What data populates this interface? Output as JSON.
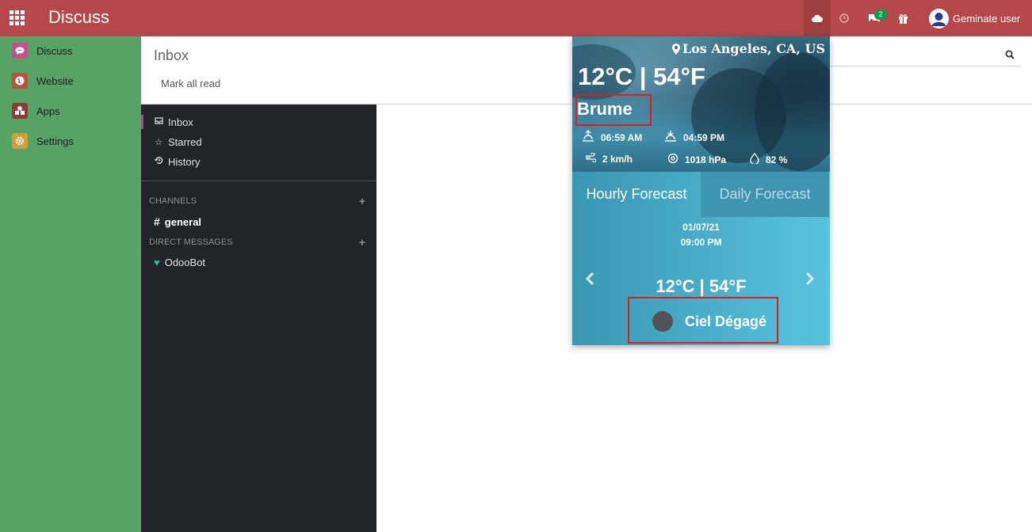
{
  "navbar": {
    "title": "Discuss",
    "chat_badge": "2",
    "user_name": "Geminate user"
  },
  "apps": [
    {
      "label": "Discuss",
      "color": "#c2528e"
    },
    {
      "label": "Website",
      "color": "#b6543d"
    },
    {
      "label": "Apps",
      "color": "#8e3b3b"
    },
    {
      "label": "Settings",
      "color": "#c9a13d"
    }
  ],
  "control_panel": {
    "title": "Inbox",
    "mark_all_read": "Mark all read"
  },
  "discuss_sidebar": {
    "mailboxes": [
      {
        "icon": "inbox-icon",
        "label": "Inbox"
      },
      {
        "icon": "star-icon",
        "label": "Starred"
      },
      {
        "icon": "history-icon",
        "label": "History"
      }
    ],
    "channels_header": "CHANNELS",
    "channels": [
      "general"
    ],
    "dm_header": "DIRECT MESSAGES",
    "direct_messages": [
      "OdooBot"
    ]
  },
  "weather": {
    "location": "Los Angeles, CA, US",
    "temperature": "12°C | 54°F",
    "condition": "Brume",
    "sunrise": "06:59 AM",
    "sunset": "04:59 PM",
    "wind": "2 km/h",
    "pressure": "1018 hPa",
    "humidity": "82 %",
    "tabs": [
      "Hourly Forecast",
      "Daily Forecast"
    ],
    "forecast": {
      "date": "01/07/21",
      "time": "09:00 PM",
      "temperature": "12°C | 54°F",
      "condition": "Ciel Dégagé"
    }
  }
}
